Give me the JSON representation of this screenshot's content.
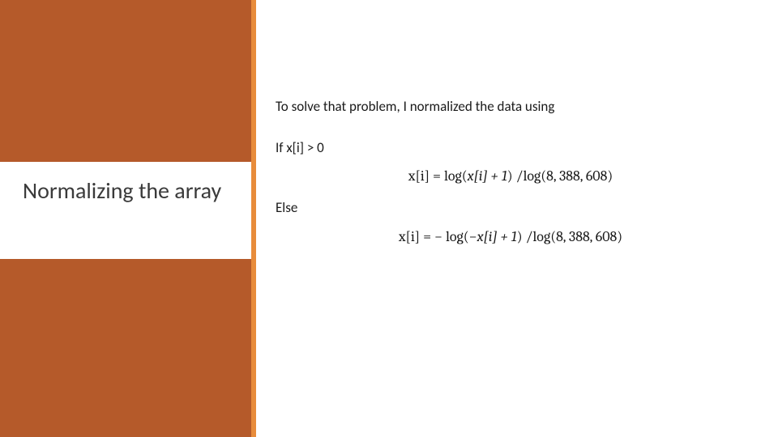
{
  "title": "Normalizing the array",
  "content": {
    "intro": "To solve that problem, I normalized the data using",
    "cond_if": "If x[i] > 0",
    "formula_positive_lhs": "x[i] =",
    "formula_positive_log1": "log(",
    "formula_positive_inner": "x[i] + 1",
    "formula_positive_close": ") /",
    "formula_positive_log2": "log(8, 388, 608)",
    "cond_else": "Else",
    "formula_negative_lhs": "x[i] = −",
    "formula_negative_log1": "log(−",
    "formula_negative_inner": "x[i] + 1",
    "formula_negative_close": ") /",
    "formula_negative_log2": "log(8, 388, 608)"
  }
}
